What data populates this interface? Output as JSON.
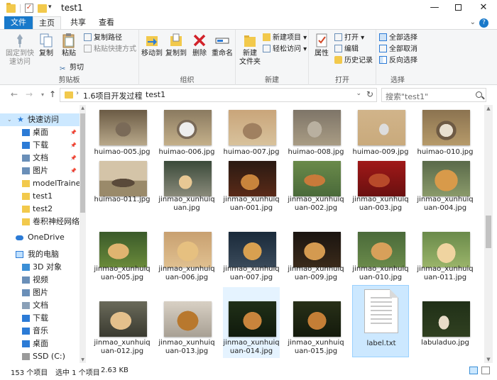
{
  "window": {
    "title": "test1",
    "minimize": "—",
    "close": "✕"
  },
  "ribbon_tabs": [
    "文件",
    "主页",
    "共享",
    "查看"
  ],
  "ribbon": {
    "clipboard": {
      "label": "剪贴板",
      "pin_line1": "固定到快",
      "pin_line2": "速访问",
      "copy": "复制",
      "paste": "粘贴",
      "copy_path": "复制路径",
      "paste_shortcut": "粘贴快捷方式",
      "cut": "剪切"
    },
    "organize": {
      "label": "组织",
      "move_to": "移动到",
      "copy_to": "复制到",
      "delete": "删除",
      "rename": "重命名"
    },
    "new": {
      "label": "新建",
      "new_folder_line1": "新建",
      "new_folder_line2": "文件夹",
      "new_item": "新建项目",
      "easy_access": "轻松访问"
    },
    "open": {
      "label": "打开",
      "properties": "属性",
      "open": "打开",
      "edit": "编辑",
      "history": "历史记录"
    },
    "select": {
      "label": "选择",
      "select_all": "全部选择",
      "select_none": "全部取消",
      "invert": "反向选择"
    }
  },
  "address": {
    "crumbs": [
      "1.6项目开发过程",
      "test1"
    ],
    "search_placeholder": "搜索\"test1\""
  },
  "nav": {
    "quick_access": "快速访问",
    "items": [
      {
        "label": "桌面",
        "icon": "desktop-icon",
        "pinned": true
      },
      {
        "label": "下载",
        "icon": "download-icon",
        "pinned": true
      },
      {
        "label": "文档",
        "icon": "documents-icon",
        "pinned": true
      },
      {
        "label": "图片",
        "icon": "pictures-icon",
        "pinned": true
      },
      {
        "label": "modelTrainer",
        "icon": "folder-icon",
        "pinned": false
      },
      {
        "label": "test1",
        "icon": "folder-icon",
        "pinned": false
      },
      {
        "label": "test2",
        "icon": "folder-icon",
        "pinned": false
      },
      {
        "label": "卷积神经网络通",
        "icon": "folder-icon",
        "pinned": false
      }
    ],
    "onedrive": "OneDrive",
    "this_pc": "我的电脑",
    "pc_items": [
      {
        "label": "3D 对象",
        "icon": "3d-objects-icon"
      },
      {
        "label": "视频",
        "icon": "videos-icon"
      },
      {
        "label": "图片",
        "icon": "pictures-icon"
      },
      {
        "label": "文档",
        "icon": "documents-icon"
      },
      {
        "label": "下载",
        "icon": "download-icon"
      },
      {
        "label": "音乐",
        "icon": "music-icon"
      },
      {
        "label": "桌面",
        "icon": "desktop-icon"
      },
      {
        "label": "SSD (C:)",
        "icon": "drive-icon"
      }
    ]
  },
  "files": [
    {
      "name": "huimao-005.jpg",
      "palette": "cat1"
    },
    {
      "name": "huimao-006.jpg",
      "palette": "cat2"
    },
    {
      "name": "huimao-007.jpg",
      "palette": "cat3"
    },
    {
      "name": "huimao-008.jpg",
      "palette": "cat4"
    },
    {
      "name": "huimao-009.jpg",
      "palette": "cat5"
    },
    {
      "name": "huimao-010.jpg",
      "palette": "cat6"
    },
    {
      "name": "huimao-011.jpg",
      "palette": "cat7"
    },
    {
      "name": "jinmao_xunhuiquan.jpg",
      "palette": "dog1"
    },
    {
      "name": "jinmao_xunhuiquan-001.jpg",
      "palette": "dog2"
    },
    {
      "name": "jinmao_xunhuiquan-002.jpg",
      "palette": "dog3"
    },
    {
      "name": "jinmao_xunhuiquan-003.jpg",
      "palette": "dog4"
    },
    {
      "name": "jinmao_xunhuiquan-004.jpg",
      "palette": "dog5"
    },
    {
      "name": "jinmao_xunhuiquan-005.jpg",
      "palette": "dog6"
    },
    {
      "name": "jinmao_xunhuiquan-006.jpg",
      "palette": "dog7"
    },
    {
      "name": "jinmao_xunhuiquan-007.jpg",
      "palette": "dog8"
    },
    {
      "name": "jinmao_xunhuiquan-009.jpg",
      "palette": "dog9"
    },
    {
      "name": "jinmao_xunhuiquan-010.jpg",
      "palette": "dog10"
    },
    {
      "name": "jinmao_xunhuiquan-011.jpg",
      "palette": "dog11"
    },
    {
      "name": "jinmao_xunhuiquan-012.jpg",
      "palette": "dog12"
    },
    {
      "name": "jinmao_xunhuiquan-013.jpg",
      "palette": "dog13"
    },
    {
      "name": "jinmao_xunhuiquan-014.jpg",
      "palette": "dog14",
      "selected_highlight": true
    },
    {
      "name": "jinmao_xunhuiquan-015.jpg",
      "palette": "dog15"
    },
    {
      "name": "label.txt",
      "palette": "txt",
      "selected": true
    },
    {
      "name": "labuladuo.jpg",
      "palette": "dog16"
    }
  ],
  "status": {
    "count": "153 个项目",
    "selected": "选中 1 个项目",
    "size": "2.63 KB"
  },
  "colors": {
    "accent": "#1979ca",
    "selection": "#cce8ff",
    "selection_border": "#99d1ff"
  }
}
